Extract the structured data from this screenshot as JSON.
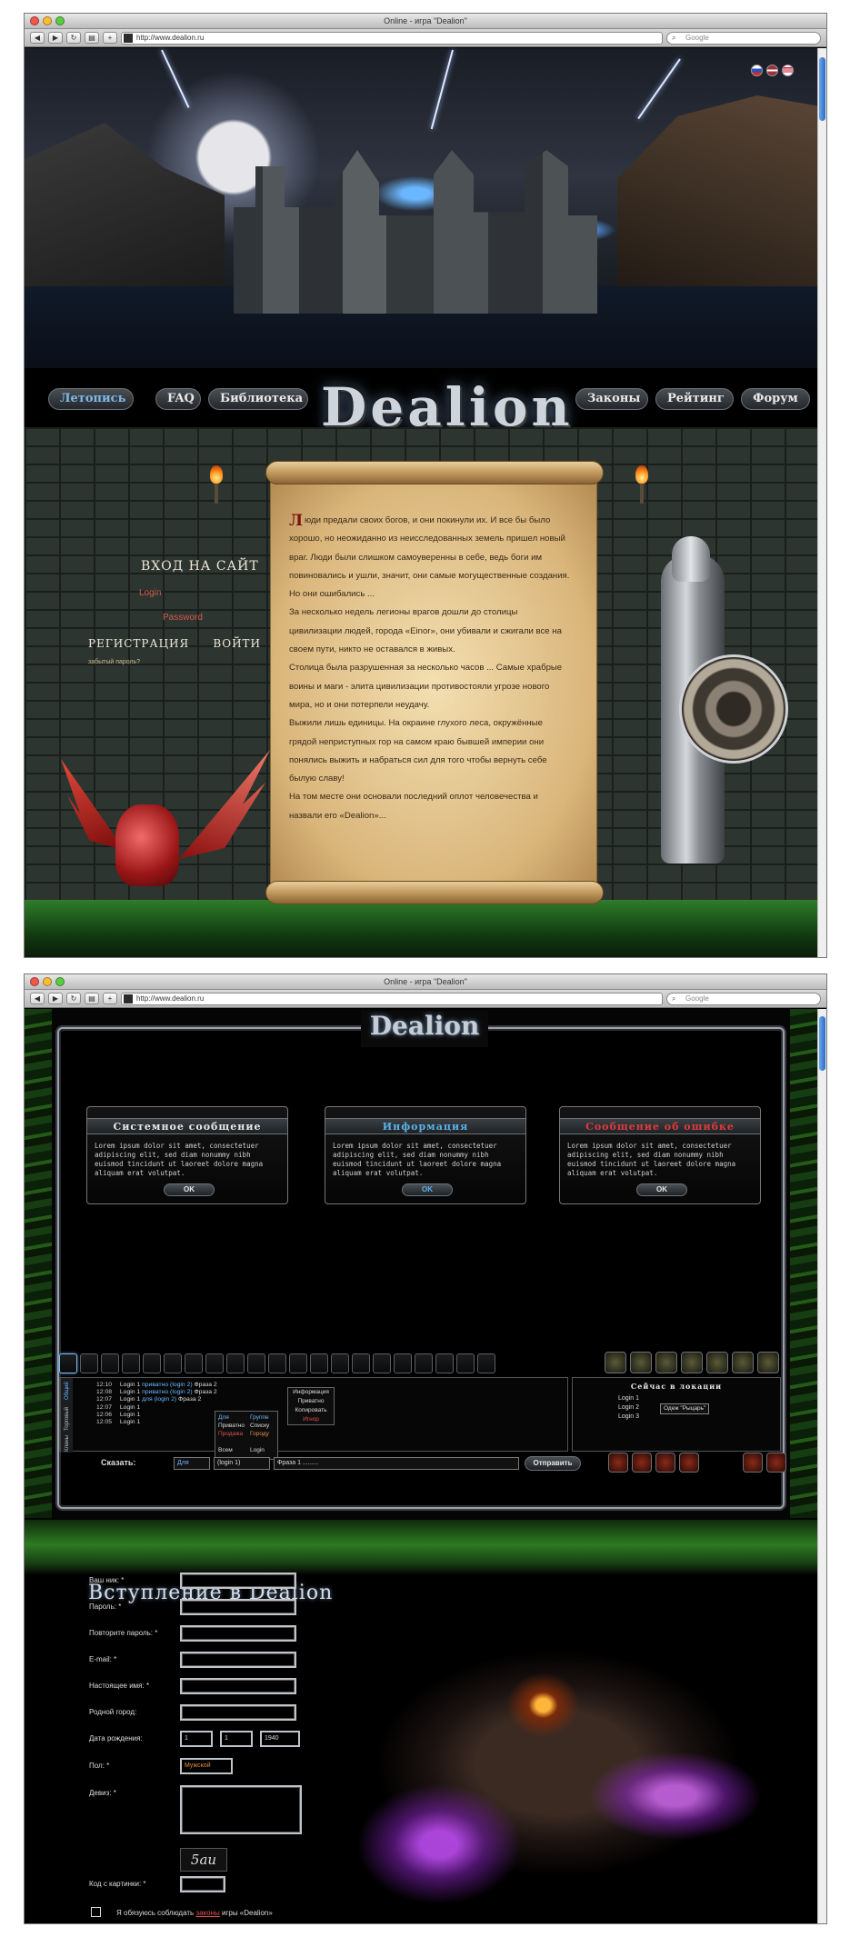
{
  "window1": {
    "title": "Online - игра \"Dealion\"",
    "url": "http://www.dealion.ru",
    "search_placeholder": "Google",
    "nav": [
      "Летопись",
      "FAQ",
      "Библиотека",
      "Законы",
      "Рейтинг",
      "Форум"
    ],
    "logo": "Dealion",
    "login": {
      "title": "ВХОД НА САЙТ",
      "login_label": "Login",
      "password_label": "Password",
      "register": "РЕГИСТРАЦИЯ",
      "enter": "ВОЙТИ",
      "forgot": "забытый пароль?"
    },
    "scroll_text": [
      "Люди предали своих богов, и они покинули их. И все бы было",
      "хорошо, но неожиданно из неисследованных земель пришел новый",
      "враг. Люди были слишком самоуверенны в себе, ведь боги им",
      "повиновались и ушли, значит, они самые могущественные создания.",
      "Но они ошибались ...",
      "За несколько недель легионы врагов дошли до столицы",
      "цивилизации людей, города «Einor», они убивали и сжигали все на",
      "своем пути, никто не оставался в живых.",
      "Столица была разрушенная за несколько часов ... Самые храбрые",
      "воины и маги - элита цивилизации противостояли угрозе нового",
      "мира, но и они потерпели неудачу.",
      "Выжили лишь единицы. На окраине глухого леса, окружённые",
      "грядой неприступных гор на самом краю бывшей империи они",
      "понялись выжить и набраться сил для того чтобы вернуть себе",
      "былую славу!",
      "На том месте они основали последний оплот человечества и",
      "назвали его «Dealion»..."
    ]
  },
  "window2": {
    "title": "Online - игра \"Dealion\"",
    "url": "http://www.dealion.ru",
    "search_placeholder": "Google",
    "logo": "Dealion",
    "dialogs": [
      {
        "title": "Системное сообщение",
        "color": "#e8e8e8",
        "body": "Lorem ipsum dolor sit amet, consectetuer adipiscing elit, sed diam nonummy nibh euismod tincidunt ut laoreet dolore magna aliquam erat volutpat.",
        "ok": "OK"
      },
      {
        "title": "Информация",
        "color": "#5ab2ea",
        "body": "Lorem ipsum dolor sit amet, consectetuer adipiscing elit, sed diam nonummy nibh euismod tincidunt ut laoreet dolore magna aliquam erat volutpat.",
        "ok": "OK"
      },
      {
        "title": "Сообщение об ошибке",
        "color": "#e03a3a",
        "body": "Lorem ipsum dolor sit amet, consectetuer adipiscing elit, sed diam nonummy nibh euismod tincidunt ut laoreet dolore magna aliquam erat volutpat.",
        "ok": "OK"
      }
    ],
    "chat_tabs": [
      "Общий",
      "Торговый",
      "Кланы"
    ],
    "chat_lines": [
      {
        "time": "12:10",
        "user": "Login 1",
        "target": "приватно (login 2)",
        "msg": "Фраза 2"
      },
      {
        "time": "12:08",
        "user": "Login 1",
        "target": "приватно (login 2)",
        "msg": "Фраза 2"
      },
      {
        "time": "12:07",
        "user": "Login 1",
        "target": "для (login 2)",
        "msg": "Фраза 2"
      },
      {
        "time": "12:07",
        "user": "Login 1",
        "target": "",
        "msg": ""
      },
      {
        "time": "12:06",
        "user": "Login 1",
        "target": "",
        "msg": ""
      },
      {
        "time": "12:05",
        "user": "Login 1",
        "target": "",
        "msg": ""
      }
    ],
    "context_menu": [
      "Информация",
      "Приватно",
      "Копировать",
      "Игнор"
    ],
    "dropdown_left": [
      "Для",
      "Приватно",
      "Продажа",
      "",
      "Всем"
    ],
    "dropdown_right": [
      "Группе",
      "Списку",
      "Городу",
      "",
      "Login"
    ],
    "location": {
      "title": "Сейчас в локации",
      "users": [
        "Login 1",
        "Login 2",
        "Login 3"
      ],
      "tooltip": "Одеж \"Рыцарь\""
    },
    "say_label": "Сказать:",
    "say_mode": "Для",
    "say_target": "(login 1)",
    "say_text": "Фраза 1 .........",
    "send": "Отправить"
  },
  "registration": {
    "title": "Вступление в Dealion",
    "fields": [
      "Ваш ник: *",
      "Пароль: *",
      "Повторите пароль: *",
      "E-mail: *",
      "Настоящее имя: *",
      "Родной город:"
    ],
    "birth_label": "Дата рождения:",
    "birth_day": "1",
    "birth_month": "1",
    "birth_year": "1940",
    "gender_label": "Пол: *",
    "gender_value": "Мужской",
    "motto_label": "Девиз: *",
    "captcha_text": "5au",
    "captcha_label": "Код с картинки: *",
    "agree_prefix": "Я обязуюсь соблюдать",
    "agree_link": "законы",
    "agree_suffix": "игры «Dealion»"
  }
}
